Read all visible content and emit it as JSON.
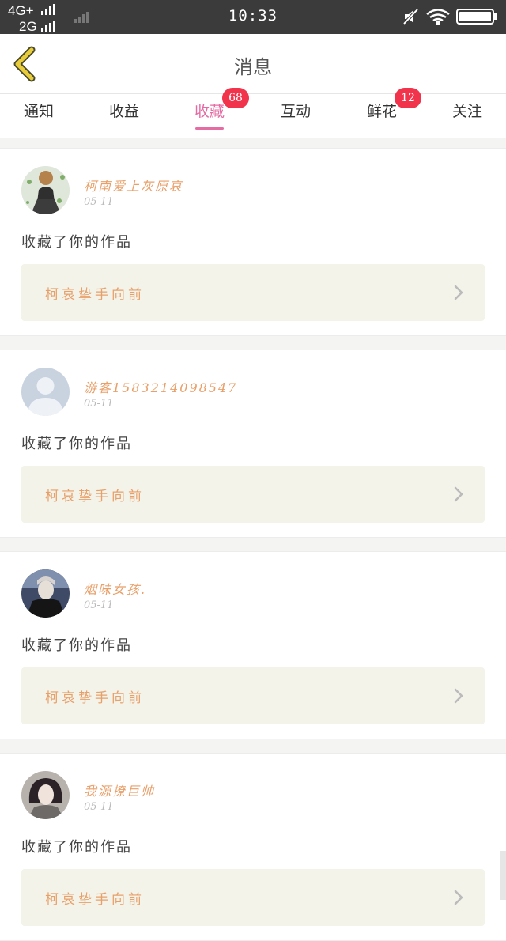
{
  "status_bar": {
    "network_top": "4G+",
    "network_bottom": "2G",
    "time": "10:33"
  },
  "header": {
    "title": "消息",
    "back_icon": "chevron-left-icon"
  },
  "tabs": [
    {
      "label": "通知",
      "badge": null,
      "active": false
    },
    {
      "label": "收益",
      "badge": null,
      "active": false
    },
    {
      "label": "收藏",
      "badge": "68",
      "active": true
    },
    {
      "label": "互动",
      "badge": null,
      "active": false
    },
    {
      "label": "鲜花",
      "badge": "12",
      "active": false
    },
    {
      "label": "关注",
      "badge": null,
      "active": false
    }
  ],
  "colors": {
    "accent": "#e56ba3",
    "badge": "#f2334c",
    "username": "#e8a06a",
    "work_box": "#f3f3e9"
  },
  "notifications": [
    {
      "username": "柯南爱上灰原哀",
      "date": "05-11",
      "action": "收藏了你的作品",
      "work_title": "柯哀挚手向前"
    },
    {
      "username": "游客15832140985​47",
      "date": "05-11",
      "action": "收藏了你的作品",
      "work_title": "柯哀挚手向前"
    },
    {
      "username": "烟味女孩.",
      "date": "05-11",
      "action": "收藏了你的作品",
      "work_title": "柯哀挚手向前"
    },
    {
      "username": "我源撩巨帅",
      "date": "05-11",
      "action": "收藏了你的作品",
      "work_title": "柯哀挚手向前"
    }
  ]
}
